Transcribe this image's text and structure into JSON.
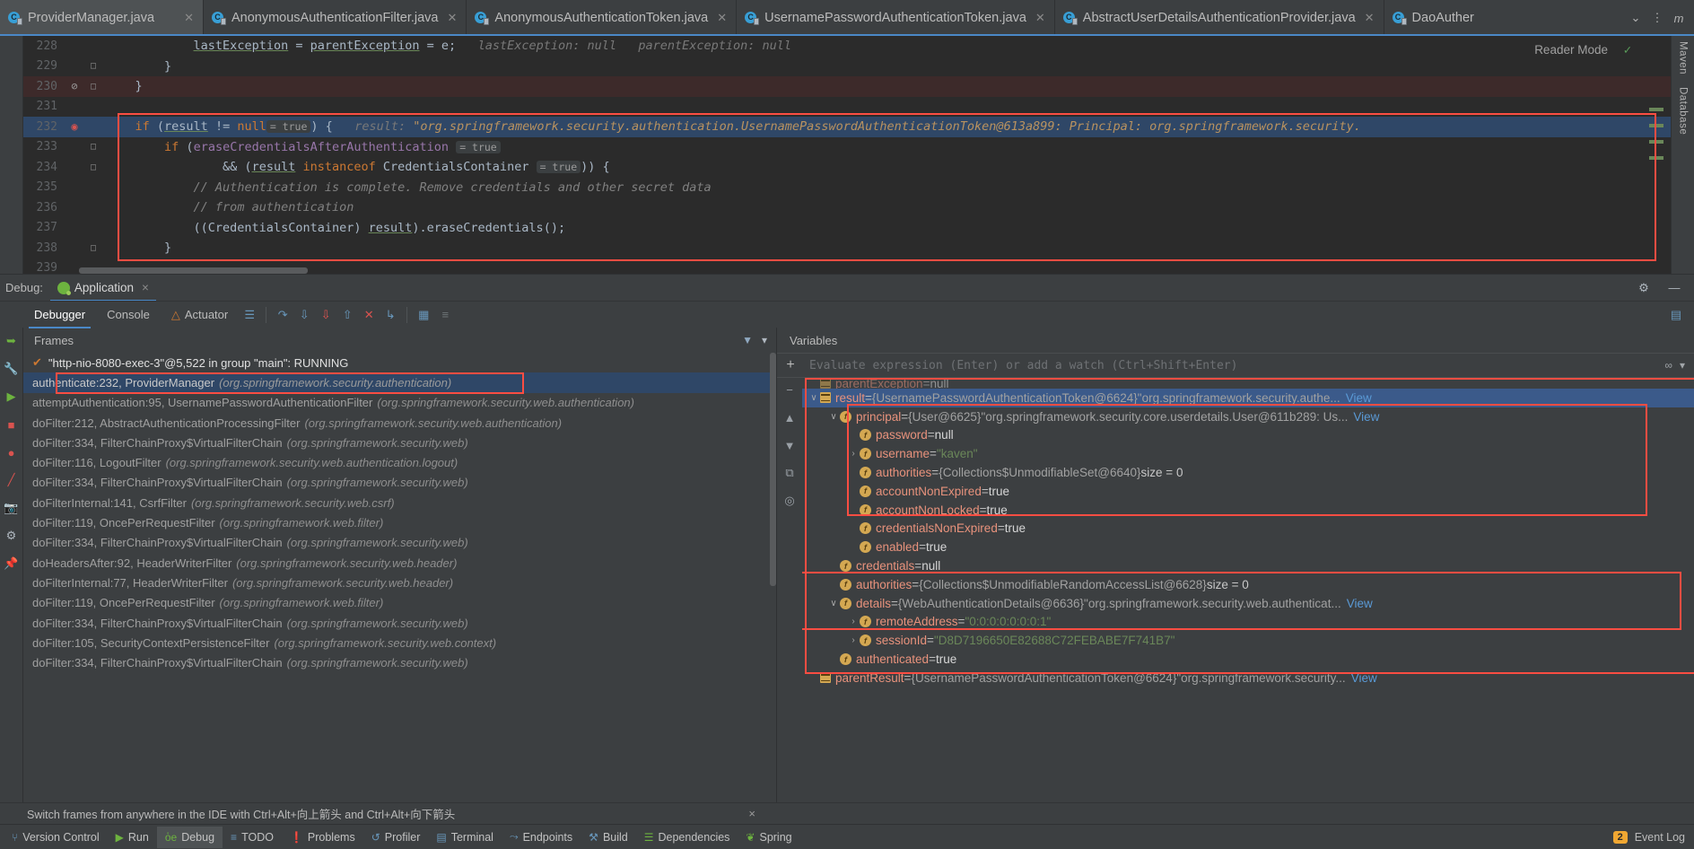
{
  "tabs": [
    {
      "label": "ProviderManager.java",
      "active": true
    },
    {
      "label": "AnonymousAuthenticationFilter.java",
      "active": false
    },
    {
      "label": "AnonymousAuthenticationToken.java",
      "active": false
    },
    {
      "label": "UsernamePasswordAuthenticationToken.java",
      "active": false
    },
    {
      "label": "AbstractUserDetailsAuthenticationProvider.java",
      "active": false
    },
    {
      "label": "DaoAuther",
      "active": false
    }
  ],
  "tabbar": {
    "chevron": "⌄",
    "more": "⋮",
    "maven_icon": "m"
  },
  "editor": {
    "reader_mode": "Reader Mode",
    "inspection_ok": "✓",
    "lines": [
      {
        "num": "228",
        "mark": "",
        "fold": "",
        "state": "normal",
        "segments": [
          {
            "t": "            ",
            "c": "id"
          },
          {
            "t": "lastException",
            "c": "var-under"
          },
          {
            "t": " = ",
            "c": "id"
          },
          {
            "t": "parentException",
            "c": "var-under"
          },
          {
            "t": " = e;   ",
            "c": "id"
          },
          {
            "t": "lastException: null   parentException: null",
            "c": "hint"
          }
        ]
      },
      {
        "num": "229",
        "mark": "",
        "fold": "□",
        "state": "normal",
        "segments": [
          {
            "t": "        }",
            "c": "id"
          }
        ]
      },
      {
        "num": "230",
        "mark": "⊘",
        "fold": "□",
        "state": "err",
        "segments": [
          {
            "t": "    }",
            "c": "id"
          }
        ]
      },
      {
        "num": "231",
        "mark": "",
        "fold": "",
        "state": "normal",
        "segments": [
          {
            "t": "",
            "c": "id"
          }
        ]
      },
      {
        "num": "232",
        "mark": "◉",
        "fold": "",
        "state": "current",
        "segments": [
          {
            "t": "    ",
            "c": "id"
          },
          {
            "t": "if",
            "c": "kw"
          },
          {
            "t": " (",
            "c": "id"
          },
          {
            "t": "result",
            "c": "var-under"
          },
          {
            "t": " != ",
            "c": "id"
          },
          {
            "t": "null",
            "c": "kw"
          },
          {
            "t": "= true",
            "c": "inlay"
          },
          {
            "t": ") {   ",
            "c": "id"
          },
          {
            "t": "result:",
            "c": "hint"
          },
          {
            "t": " \"org.springframework.security.authentication.UsernamePasswordAuthenticationToken@613a899: Principal: org.springframework.security.",
            "c": "hint-val"
          }
        ]
      },
      {
        "num": "233",
        "mark": "",
        "fold": "□",
        "state": "normal",
        "segments": [
          {
            "t": "        ",
            "c": "id"
          },
          {
            "t": "if",
            "c": "kw"
          },
          {
            "t": " (",
            "c": "id"
          },
          {
            "t": "eraseCredentialsAfterAuthentication",
            "c": "fld"
          },
          {
            "t": " ",
            "c": "id"
          },
          {
            "t": "= true",
            "c": "inlay"
          }
        ]
      },
      {
        "num": "234",
        "mark": "",
        "fold": "□",
        "state": "normal",
        "segments": [
          {
            "t": "                && (",
            "c": "id"
          },
          {
            "t": "result",
            "c": "var-under"
          },
          {
            "t": " ",
            "c": "id"
          },
          {
            "t": "instanceof",
            "c": "kw"
          },
          {
            "t": " CredentialsContainer ",
            "c": "id"
          },
          {
            "t": "= true",
            "c": "inlay"
          },
          {
            "t": ")) {",
            "c": "id"
          }
        ]
      },
      {
        "num": "235",
        "mark": "",
        "fold": "",
        "state": "normal",
        "segments": [
          {
            "t": "            ",
            "c": "id"
          },
          {
            "t": "// Authentication is complete. Remove credentials and other secret data",
            "c": "cmt"
          }
        ]
      },
      {
        "num": "236",
        "mark": "",
        "fold": "",
        "state": "normal",
        "segments": [
          {
            "t": "            ",
            "c": "id"
          },
          {
            "t": "// from authentication",
            "c": "cmt"
          }
        ]
      },
      {
        "num": "237",
        "mark": "",
        "fold": "",
        "state": "normal",
        "segments": [
          {
            "t": "            ((CredentialsContainer) ",
            "c": "id"
          },
          {
            "t": "result",
            "c": "var-under"
          },
          {
            "t": ").eraseCredentials();",
            "c": "id"
          }
        ]
      },
      {
        "num": "238",
        "mark": "",
        "fold": "□",
        "state": "normal",
        "segments": [
          {
            "t": "        }",
            "c": "id"
          }
        ]
      },
      {
        "num": "239",
        "mark": "",
        "fold": "",
        "state": "normal",
        "segments": [
          {
            "t": "",
            "c": "id"
          }
        ]
      }
    ]
  },
  "right_rail": {
    "maven": "Maven",
    "database": "Database"
  },
  "debug": {
    "label": "Debug:",
    "session_tab": "Application",
    "session_close": "×",
    "gear": "⚙",
    "minimize": "—",
    "tabs": [
      {
        "label": "Debugger",
        "active": true
      },
      {
        "label": "Console",
        "active": false
      },
      {
        "label": "Actuator",
        "active": false
      }
    ],
    "toolbar_icons": [
      "☰",
      "⤴",
      "↓",
      "⬇",
      "↑",
      "✕",
      "↳",
      "▦",
      "≡"
    ]
  },
  "frames": {
    "title": "Frames",
    "filter_icon": "ᵛ",
    "dropdown_icon": "▾",
    "thread": "\"http-nio-8080-exec-3\"@5,522 in group \"main\": RUNNING",
    "rows": [
      {
        "method": "authenticate:232, ProviderManager",
        "pkg": "(org.springframework.security.authentication)",
        "selected": true
      },
      {
        "method": "attemptAuthentication:95, UsernamePasswordAuthenticationFilter",
        "pkg": "(org.springframework.security.web.authentication)",
        "selected": false
      },
      {
        "method": "doFilter:212, AbstractAuthenticationProcessingFilter",
        "pkg": "(org.springframework.security.web.authentication)",
        "selected": false
      },
      {
        "method": "doFilter:334, FilterChainProxy$VirtualFilterChain",
        "pkg": "(org.springframework.security.web)",
        "selected": false
      },
      {
        "method": "doFilter:116, LogoutFilter",
        "pkg": "(org.springframework.security.web.authentication.logout)",
        "selected": false
      },
      {
        "method": "doFilter:334, FilterChainProxy$VirtualFilterChain",
        "pkg": "(org.springframework.security.web)",
        "selected": false
      },
      {
        "method": "doFilterInternal:141, CsrfFilter",
        "pkg": "(org.springframework.security.web.csrf)",
        "selected": false
      },
      {
        "method": "doFilter:119, OncePerRequestFilter",
        "pkg": "(org.springframework.web.filter)",
        "selected": false
      },
      {
        "method": "doFilter:334, FilterChainProxy$VirtualFilterChain",
        "pkg": "(org.springframework.security.web)",
        "selected": false
      },
      {
        "method": "doHeadersAfter:92, HeaderWriterFilter",
        "pkg": "(org.springframework.security.web.header)",
        "selected": false
      },
      {
        "method": "doFilterInternal:77, HeaderWriterFilter",
        "pkg": "(org.springframework.security.web.header)",
        "selected": false
      },
      {
        "method": "doFilter:119, OncePerRequestFilter",
        "pkg": "(org.springframework.web.filter)",
        "selected": false
      },
      {
        "method": "doFilter:334, FilterChainProxy$VirtualFilterChain",
        "pkg": "(org.springframework.security.web)",
        "selected": false
      },
      {
        "method": "doFilter:105, SecurityContextPersistenceFilter",
        "pkg": "(org.springframework.security.web.context)",
        "selected": false
      },
      {
        "method": "doFilter:334, FilterChainProxy$VirtualFilterChain",
        "pkg": "(org.springframework.security.web)",
        "selected": false
      }
    ]
  },
  "variables": {
    "title": "Variables",
    "eval_placeholder": "Evaluate expression (Enter) or add a watch (Ctrl+Shift+Enter)",
    "eval_value": "",
    "eval_icons": [
      "∞",
      "▾"
    ],
    "gutter_icons": [
      "+",
      "−",
      "▲",
      "▼",
      "⧉",
      "◎"
    ],
    "view_label": "View",
    "rows": [
      {
        "indent": 0,
        "arrow": "",
        "icon": "obj",
        "name": "parentException",
        "eq": "=",
        "value": "null",
        "vclass": "vnull",
        "selected": false,
        "clipped": true
      },
      {
        "indent": 0,
        "arrow": "∨",
        "icon": "obj",
        "name": "result",
        "eq": "=",
        "type": "{UsernamePasswordAuthenticationToken@6624}",
        "value": "\"org.springframework.security.authe...",
        "vclass": "vtype",
        "view": "View",
        "selected": true
      },
      {
        "indent": 1,
        "arrow": "∨",
        "icon": "f",
        "name": "principal",
        "eq": "=",
        "type": "{User@6625}",
        "value": "\"org.springframework.security.core.userdetails.User@611b289: Us...",
        "vclass": "vtype",
        "view": "View",
        "selected": false
      },
      {
        "indent": 2,
        "arrow": "",
        "icon": "f",
        "name": "password",
        "eq": "=",
        "value": "null",
        "vclass": "vnull",
        "selected": false
      },
      {
        "indent": 2,
        "arrow": "›",
        "icon": "f",
        "name": "username",
        "eq": "=",
        "value": "\"kaven\"",
        "vclass": "vstr",
        "selected": false
      },
      {
        "indent": 2,
        "arrow": "",
        "icon": "f",
        "name": "authorities",
        "eq": "=",
        "type": "{Collections$UnmodifiableSet@6640}",
        "value": "size = 0",
        "vclass": "vsize",
        "selected": false
      },
      {
        "indent": 2,
        "arrow": "",
        "icon": "f",
        "name": "accountNonExpired",
        "eq": "=",
        "value": "true",
        "vclass": "vbool",
        "selected": false
      },
      {
        "indent": 2,
        "arrow": "",
        "icon": "f",
        "name": "accountNonLocked",
        "eq": "=",
        "value": "true",
        "vclass": "vbool",
        "selected": false
      },
      {
        "indent": 2,
        "arrow": "",
        "icon": "f",
        "name": "credentialsNonExpired",
        "eq": "=",
        "value": "true",
        "vclass": "vbool",
        "selected": false
      },
      {
        "indent": 2,
        "arrow": "",
        "icon": "f",
        "name": "enabled",
        "eq": "=",
        "value": "true",
        "vclass": "vbool",
        "selected": false
      },
      {
        "indent": 1,
        "arrow": "",
        "icon": "f",
        "name": "credentials",
        "eq": "=",
        "value": "null",
        "vclass": "vnull",
        "selected": false
      },
      {
        "indent": 1,
        "arrow": "",
        "icon": "f",
        "name": "authorities",
        "eq": "=",
        "type": "{Collections$UnmodifiableRandomAccessList@6628}",
        "value": "size = 0",
        "vclass": "vsize",
        "selected": false
      },
      {
        "indent": 1,
        "arrow": "∨",
        "icon": "f",
        "name": "details",
        "eq": "=",
        "type": "{WebAuthenticationDetails@6636}",
        "value": "\"org.springframework.security.web.authenticat...",
        "vclass": "vtype",
        "view": "View",
        "selected": false
      },
      {
        "indent": 2,
        "arrow": "›",
        "icon": "f",
        "name": "remoteAddress",
        "eq": "=",
        "value": "\"0:0:0:0:0:0:0:1\"",
        "vclass": "vstr",
        "selected": false
      },
      {
        "indent": 2,
        "arrow": "›",
        "icon": "f",
        "name": "sessionId",
        "eq": "=",
        "value": "\"D8D7196650E82688C72FEBABE7F741B7\"",
        "vclass": "vstr",
        "selected": false
      },
      {
        "indent": 1,
        "arrow": "",
        "icon": "f",
        "name": "authenticated",
        "eq": "=",
        "value": "true",
        "vclass": "vbool",
        "selected": false
      },
      {
        "indent": 0,
        "arrow": "",
        "icon": "obj",
        "name": "parentResult",
        "eq": "=",
        "type": "{UsernamePasswordAuthenticationToken@6624}",
        "value": "\"org.springframework.security...",
        "vclass": "vtype",
        "view": "View",
        "selected": false
      }
    ]
  },
  "hint_bar": {
    "text": "Switch frames from anywhere in the IDE with Ctrl+Alt+向上箭头 and Ctrl+Alt+向下箭头",
    "close": "×"
  },
  "statusbar": {
    "items": [
      {
        "label": "Version Control",
        "icon": "⑂",
        "icon_class": "g-blue",
        "active": false
      },
      {
        "label": "Run",
        "icon": "▶",
        "icon_class": "g-green",
        "active": false
      },
      {
        "label": "Debug",
        "icon": "ὁe",
        "icon_class": "g-green",
        "active": true
      },
      {
        "label": "TODO",
        "icon": "≡",
        "icon_class": "g-blue",
        "active": false
      },
      {
        "label": "Problems",
        "icon": "❗",
        "icon_class": "g-red",
        "active": false
      },
      {
        "label": "Profiler",
        "icon": "↺",
        "icon_class": "g-blue",
        "active": false
      },
      {
        "label": "Terminal",
        "icon": "▤",
        "icon_class": "g-blue",
        "active": false
      },
      {
        "label": "Endpoints",
        "icon": "⤳",
        "icon_class": "g-blue",
        "active": false
      },
      {
        "label": "Build",
        "icon": "⚒",
        "icon_class": "g-blue",
        "active": false
      },
      {
        "label": "Dependencies",
        "icon": "☰",
        "icon_class": "g-green",
        "active": false
      },
      {
        "label": "Spring",
        "icon": "❦",
        "icon_class": "g-green",
        "active": false
      }
    ],
    "event_log": "Event Log",
    "event_count": "2"
  },
  "colors": {
    "accent": "#4a88c7",
    "highlight_box": "#fb4d42",
    "selection": "#2f4767",
    "var_selection": "#3b5a8a",
    "editor_bg": "#2b2b2b",
    "panel_bg": "#3c3f41"
  }
}
